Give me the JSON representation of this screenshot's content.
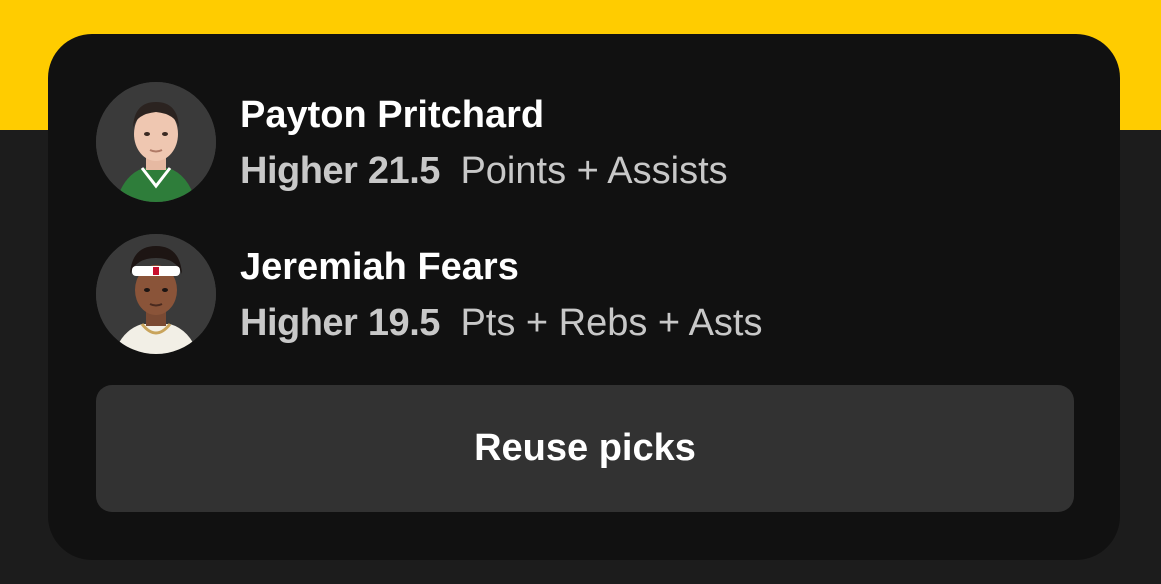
{
  "picks": [
    {
      "player_name": "Payton Pritchard",
      "direction": "Higher",
      "line": "21.5",
      "stat": "Points + Assists",
      "avatar_icon": "player-headshot-icon",
      "jersey_color": "#2e7d3a"
    },
    {
      "player_name": "Jeremiah Fears",
      "direction": "Higher",
      "line": "19.5",
      "stat": "Pts + Rebs + Asts",
      "avatar_icon": "player-headshot-icon",
      "jersey_color": "#f2efe6"
    }
  ],
  "reuse_button_label": "Reuse picks",
  "colors": {
    "accent": "#ffcc00",
    "card_bg": "#111111",
    "button_bg": "#323232",
    "secondary_text": "#c8c8c8"
  }
}
